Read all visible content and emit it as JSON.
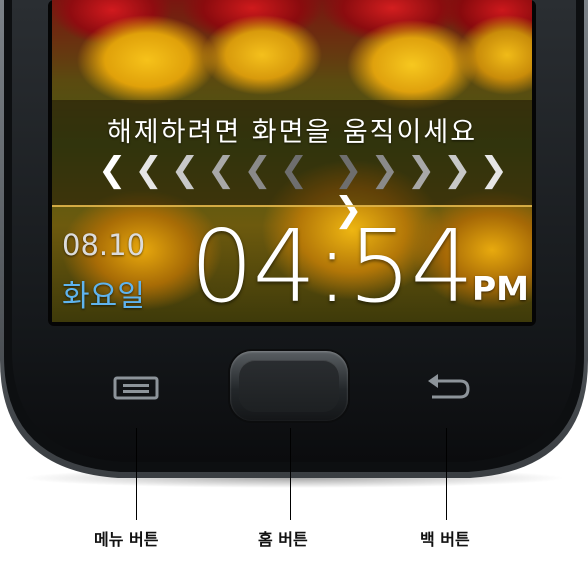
{
  "lockscreen": {
    "unlock_prompt": "해제하려면 화면을 움직이세요",
    "chevrons_left": [
      "❮",
      "❮",
      "❮",
      "❮",
      "❮",
      "❮"
    ],
    "chevrons_right": [
      "❯",
      "❯",
      "❯",
      "❯",
      "❯",
      "❯"
    ],
    "date": "08.10",
    "weekday": "화요일",
    "time": "04:54",
    "ampm": "PM"
  },
  "hardware_keys": {
    "menu_icon": "menu-icon",
    "home_icon": "home-button",
    "back_icon": "back-arrow-icon"
  },
  "labels": {
    "menu": "메뉴 버튼",
    "home": "홈 버튼",
    "back": "백 버튼"
  },
  "colors": {
    "weekday": "#5fb4ee",
    "unlock_line": "#e1b64a",
    "body": "#1c1f22"
  }
}
